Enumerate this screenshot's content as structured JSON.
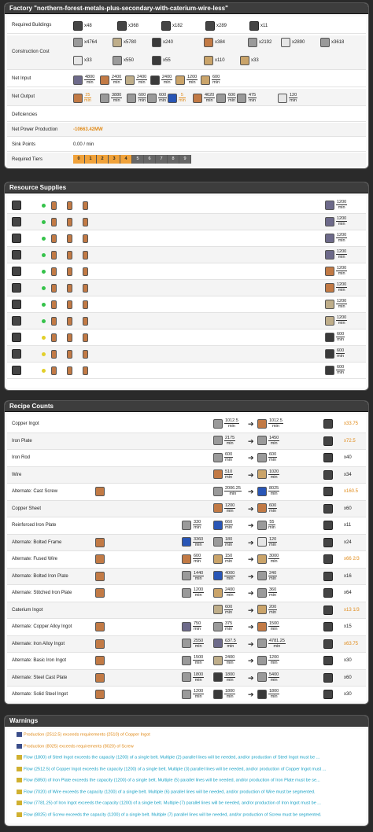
{
  "factory": {
    "title": "Factory \"northern-forest-metals-plus-secondary-with-caterium-wire-less\"",
    "labels": {
      "buildings": "Required Buildings",
      "cost": "Construction Cost",
      "input": "Net Input",
      "output": "Net Output",
      "deficiencies": "Deficiencies",
      "power": "Net Power Production",
      "sink": "Sink Points",
      "tiers": "Required Tiers"
    },
    "buildings": [
      {
        "icon": "constructor-icon",
        "count": "x48"
      },
      {
        "icon": "assembler-icon",
        "count": "x368"
      },
      {
        "icon": "smelter-icon",
        "count": "x182"
      },
      {
        "icon": "foundry-icon",
        "count": "x289"
      },
      {
        "icon": "miner-icon",
        "count": "x11"
      }
    ],
    "cost_row1": [
      {
        "icon": "reinforced-plate-icon",
        "count": "x4764"
      },
      {
        "icon": "concrete-icon",
        "count": "x5780"
      },
      {
        "icon": "cable-icon",
        "count": "x240"
      },
      {
        "icon": "copper-sheet-icon",
        "count": "x384"
      },
      {
        "icon": "iron-rod-icon",
        "count": "x2192"
      },
      {
        "icon": "frame-icon",
        "count": "x2890"
      },
      {
        "icon": "rotor-icon",
        "count": "x3618"
      }
    ],
    "cost_row2": [
      {
        "icon": "modular-frame-icon",
        "count": "x33"
      },
      {
        "icon": "iron-plate-icon",
        "count": "x550"
      },
      {
        "icon": "motor-icon",
        "count": "x55"
      },
      {
        "icon": "wire-icon",
        "count": "x110"
      },
      {
        "icon": "stator-icon",
        "count": "x33"
      }
    ],
    "inputs": [
      {
        "icon": "iron-ore-icon",
        "num": "4800",
        "den": "min"
      },
      {
        "icon": "copper-ore-icon",
        "num": "2400",
        "den": "min"
      },
      {
        "icon": "limestone-icon",
        "num": "2400",
        "den": "min"
      },
      {
        "icon": "coal-icon",
        "num": "2400",
        "den": "min"
      },
      {
        "icon": "caterium-ore-icon",
        "num": "1200",
        "den": "min"
      },
      {
        "icon": "sulfur-icon",
        "num": "600",
        "den": "min"
      }
    ],
    "outputs": [
      {
        "icon": "copper-ingot-icon",
        "num": "25",
        "den": "min",
        "hl": true
      },
      {
        "icon": "iron-plate-icon",
        "num": "3880",
        "den": "min"
      },
      {
        "icon": "steel-pipe-icon",
        "num": "600",
        "den": "min"
      },
      {
        "icon": "steel-beam-icon",
        "num": "600",
        "den": "min"
      },
      {
        "icon": "screw-icon",
        "num": "5",
        "den": "min",
        "hl": true
      },
      {
        "icon": "copper-sheet-icon",
        "num": "4620",
        "den": "min"
      },
      {
        "icon": "iron-rod-icon",
        "num": "600",
        "den": "min"
      },
      {
        "icon": "reinforced-plate-icon",
        "num": "475",
        "den": "min"
      },
      {
        "icon": "frame-icon",
        "num": "120",
        "den": "min"
      }
    ],
    "power": "-10663.42MW",
    "sink": "0.00 / min",
    "tiers": [
      "0",
      "1",
      "2",
      "3",
      "4",
      "5",
      "6",
      "7",
      "8",
      "9"
    ]
  },
  "supplies": {
    "title": "Resource Supplies",
    "rows": [
      {
        "status": "green",
        "num": "1200",
        "den": "min",
        "res": "iron-ore-icon"
      },
      {
        "status": "green",
        "num": "1200",
        "den": "min",
        "res": "iron-ore-icon"
      },
      {
        "status": "green",
        "num": "1200",
        "den": "min",
        "res": "iron-ore-icon"
      },
      {
        "status": "green",
        "num": "1200",
        "den": "min",
        "res": "iron-ore-icon"
      },
      {
        "status": "green",
        "num": "1200",
        "den": "min",
        "res": "copper-ore-icon"
      },
      {
        "status": "green",
        "num": "1200",
        "den": "min",
        "res": "copper-ore-icon"
      },
      {
        "status": "green",
        "num": "1200",
        "den": "min",
        "res": "limestone-icon"
      },
      {
        "status": "green",
        "num": "1200",
        "den": "min",
        "res": "limestone-icon"
      },
      {
        "status": "yellow",
        "num": "600",
        "den": "min",
        "res": "coal-icon"
      },
      {
        "status": "yellow",
        "num": "600",
        "den": "min",
        "res": "coal-icon"
      },
      {
        "status": "yellow",
        "num": "600",
        "den": "min",
        "res": "coal-icon"
      }
    ]
  },
  "recipes": {
    "title": "Recipe Counts",
    "rows": [
      {
        "name": "Copper Ingot",
        "alt": false,
        "inputs": [
          {
            "num": "1012.5",
            "den": "min",
            "c": "gray"
          }
        ],
        "outputs": [
          {
            "num": "1012.5",
            "den": "min",
            "c": "copper"
          }
        ],
        "count": "x33.75",
        "orange": true
      },
      {
        "name": "Iron Plate",
        "alt": false,
        "inputs": [
          {
            "num": "2175",
            "den": "min",
            "c": "gray"
          }
        ],
        "outputs": [
          {
            "num": "1450",
            "den": "min",
            "c": "gray"
          }
        ],
        "count": "x72.5",
        "orange": true
      },
      {
        "name": "Iron Rod",
        "alt": false,
        "inputs": [
          {
            "num": "600",
            "den": "min",
            "c": "gray"
          }
        ],
        "outputs": [
          {
            "num": "600",
            "den": "min",
            "c": "gray"
          }
        ],
        "count": "x40",
        "orange": false
      },
      {
        "name": "Wire",
        "alt": false,
        "inputs": [
          {
            "num": "510",
            "den": "min",
            "c": "copper"
          }
        ],
        "outputs": [
          {
            "num": "1020",
            "den": "min",
            "c": "wire"
          }
        ],
        "count": "x34",
        "orange": false
      },
      {
        "name": "Alternate: Cast Screw",
        "alt": true,
        "inputs": [
          {
            "num": "2006.25",
            "den": "min",
            "c": "gray"
          }
        ],
        "outputs": [
          {
            "num": "8025",
            "den": "min",
            "c": "blue"
          }
        ],
        "count": "x160.5",
        "orange": true
      },
      {
        "name": "Copper Sheet",
        "alt": false,
        "inputs": [
          {
            "num": "1200",
            "den": "min",
            "c": "copper"
          }
        ],
        "outputs": [
          {
            "num": "600",
            "den": "min",
            "c": "copper"
          }
        ],
        "count": "x60",
        "orange": false
      },
      {
        "name": "Reinforced Iron Plate",
        "alt": false,
        "inputs": [
          {
            "num": "330",
            "den": "min",
            "c": "gray"
          },
          {
            "num": "660",
            "den": "min",
            "c": "blue"
          }
        ],
        "outputs": [
          {
            "num": "55",
            "den": "min",
            "c": "gray"
          }
        ],
        "count": "x11",
        "orange": false
      },
      {
        "name": "Alternate: Bolted Frame",
        "alt": true,
        "inputs": [
          {
            "num": "3360",
            "den": "min",
            "c": "blue"
          },
          {
            "num": "180",
            "den": "min",
            "c": "gray"
          }
        ],
        "outputs": [
          {
            "num": "120",
            "den": "min",
            "c": "white"
          }
        ],
        "count": "x24",
        "orange": false
      },
      {
        "name": "Alternate: Fused Wire",
        "alt": true,
        "inputs": [
          {
            "num": "600",
            "den": "min",
            "c": "copper"
          },
          {
            "num": "150",
            "den": "min",
            "c": "wire"
          }
        ],
        "outputs": [
          {
            "num": "3000",
            "den": "min",
            "c": "wire"
          }
        ],
        "count": "x66 2/3",
        "orange": true
      },
      {
        "name": "Alternate: Bolted Iron Plate",
        "alt": true,
        "inputs": [
          {
            "num": "1440",
            "den": "min",
            "c": "gray"
          },
          {
            "num": "4000",
            "den": "min",
            "c": "blue"
          }
        ],
        "outputs": [
          {
            "num": "240",
            "den": "min",
            "c": "gray"
          }
        ],
        "count": "x16",
        "orange": false
      },
      {
        "name": "Alternate: Stitched Iron Plate",
        "alt": true,
        "inputs": [
          {
            "num": "1200",
            "den": "min",
            "c": "gray"
          },
          {
            "num": "2400",
            "den": "min",
            "c": "wire"
          }
        ],
        "outputs": [
          {
            "num": "360",
            "den": "min",
            "c": "gray"
          }
        ],
        "count": "x64",
        "orange": false
      },
      {
        "name": "Caterium Ingot",
        "alt": false,
        "inputs": [
          {
            "num": "600",
            "den": "min",
            "c": "tan"
          }
        ],
        "outputs": [
          {
            "num": "200",
            "den": "min",
            "c": "wire"
          }
        ],
        "count": "x13 1/3",
        "orange": true
      },
      {
        "name": "Alternate: Copper Alloy Ingot",
        "alt": true,
        "inputs": [
          {
            "num": "750",
            "den": "min",
            "c": "purple"
          },
          {
            "num": "375",
            "den": "min",
            "c": "gray"
          }
        ],
        "outputs": [
          {
            "num": "1500",
            "den": "min",
            "c": "copper"
          }
        ],
        "count": "x15",
        "orange": false
      },
      {
        "name": "Alternate: Iron Alloy Ingot",
        "alt": true,
        "inputs": [
          {
            "num": "2550",
            "den": "min",
            "c": "gray"
          },
          {
            "num": "637.5",
            "den": "min",
            "c": "purple"
          }
        ],
        "outputs": [
          {
            "num": "4781.25",
            "den": "min",
            "c": "gray"
          }
        ],
        "count": "x63.75",
        "orange": true
      },
      {
        "name": "Alternate: Basic Iron Ingot",
        "alt": true,
        "inputs": [
          {
            "num": "1500",
            "den": "min",
            "c": "gray"
          },
          {
            "num": "2400",
            "den": "min",
            "c": "tan"
          }
        ],
        "outputs": [
          {
            "num": "1200",
            "den": "min",
            "c": "gray"
          }
        ],
        "count": "x30",
        "orange": false
      },
      {
        "name": "Alternate: Steel Cast Plate",
        "alt": true,
        "inputs": [
          {
            "num": "1800",
            "den": "min",
            "c": "gray"
          },
          {
            "num": "1800",
            "den": "min",
            "c": "dark"
          }
        ],
        "outputs": [
          {
            "num": "5400",
            "den": "min",
            "c": "gray"
          }
        ],
        "count": "x60",
        "orange": false
      },
      {
        "name": "Alternate: Solid Steel Ingot",
        "alt": true,
        "inputs": [
          {
            "num": "1200",
            "den": "min",
            "c": "gray"
          },
          {
            "num": "1800",
            "den": "min",
            "c": "dark"
          }
        ],
        "outputs": [
          {
            "num": "1800",
            "den": "min",
            "c": "dark"
          }
        ],
        "count": "x30",
        "orange": false
      }
    ]
  },
  "warnings": {
    "title": "Warnings",
    "items": [
      {
        "kind": "orange",
        "text": "Production (2512.5) exceeds requirements (2510) of Copper Ingot"
      },
      {
        "kind": "orange",
        "text": "Production (8025) exceeds requirements (8020) of Screw"
      },
      {
        "kind": "cyan",
        "text": "Flow (1800) of Steel Ingot exceeds the capacity (1200) of a single belt. Multiple (2) parallel lines will be needed, and/or production of Steel Ingot must be ..."
      },
      {
        "kind": "cyan",
        "text": "Flow (2512.5) of Copper Ingot exceeds the capacity (1200) of a single belt. Multiple (3) parallel lines will be needed, and/or production of Copper Ingot must ..."
      },
      {
        "kind": "cyan",
        "text": "Flow (5850) of Iron Plate exceeds the capacity (1200) of a single belt. Multiple (5) parallel lines will be needed, and/or production of Iron Plate must be se..."
      },
      {
        "kind": "cyan",
        "text": "Flow (7020) of Wire exceeds the capacity (1200) of a single belt. Multiple (6) parallel lines will be needed, and/or production of Wire must be segmented."
      },
      {
        "kind": "cyan",
        "text": "Flow (7781.25) of Iron Ingot exceeds the capacity (1200) of a single belt. Multiple (7) parallel lines will be needed, and/or production of Iron Ingot must be ..."
      },
      {
        "kind": "cyan",
        "text": "Flow (8025) of Screw exceeds the capacity (1200) of a single belt. Multiple (7) parallel lines will be needed, and/or production of Screw must be segmented."
      }
    ]
  }
}
